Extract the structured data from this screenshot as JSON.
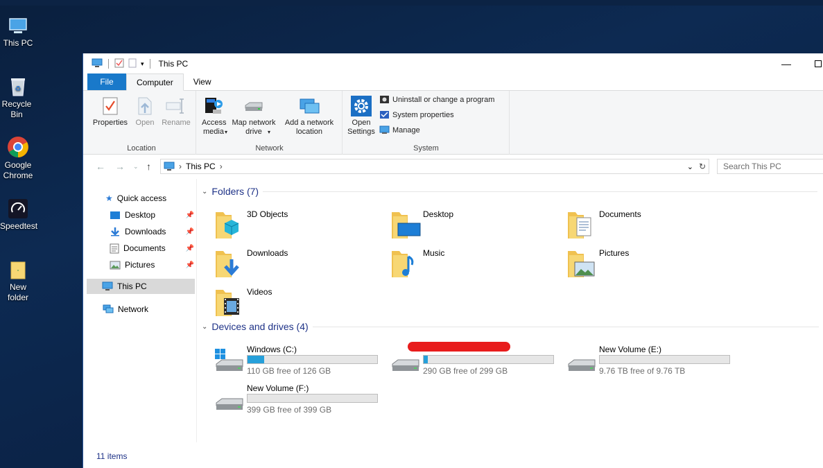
{
  "desktop": {
    "icons": [
      {
        "label": "This PC"
      },
      {
        "label": "Recycle Bin"
      },
      {
        "label": "Google Chrome"
      },
      {
        "label": "Speedtest"
      },
      {
        "label": "New folder"
      }
    ]
  },
  "window": {
    "title": "This PC",
    "tabs": {
      "file": "File",
      "computer": "Computer",
      "view": "View"
    },
    "ribbon": {
      "location": {
        "label": "Location",
        "properties": "Properties",
        "open": "Open",
        "rename": "Rename"
      },
      "network": {
        "label": "Network",
        "access_media": "Access media",
        "map_drive": "Map network drive",
        "add_location": "Add a network location"
      },
      "system": {
        "label": "System",
        "open_settings": "Open Settings",
        "uninstall": "Uninstall or change a program",
        "sys_props": "System properties",
        "manage": "Manage"
      }
    },
    "address": {
      "path": "This PC",
      "search_placeholder": "Search This PC"
    },
    "nav": {
      "quick_access": "Quick access",
      "desktop": "Desktop",
      "downloads": "Downloads",
      "documents": "Documents",
      "pictures": "Pictures",
      "this_pc": "This PC",
      "network": "Network"
    },
    "folders_header": "Folders (7)",
    "folders": [
      "3D Objects",
      "Desktop",
      "Documents",
      "Downloads",
      "Music",
      "Pictures",
      "Videos"
    ],
    "drives_header": "Devices and drives (4)",
    "drives": [
      {
        "name": "Windows (C:)",
        "free": "110 GB free of 126 GB",
        "used_fraction": 0.13
      },
      {
        "name": "",
        "free": "290 GB free of 299 GB",
        "used_fraction": 0.03
      },
      {
        "name": "New Volume (E:)",
        "free": "9.76 TB free of 9.76 TB",
        "used_fraction": 0.0
      },
      {
        "name": "New Volume (F:)",
        "free": "399 GB free of 399 GB",
        "used_fraction": 0.0
      }
    ],
    "status": "11 items",
    "accent": "#1979ca"
  }
}
